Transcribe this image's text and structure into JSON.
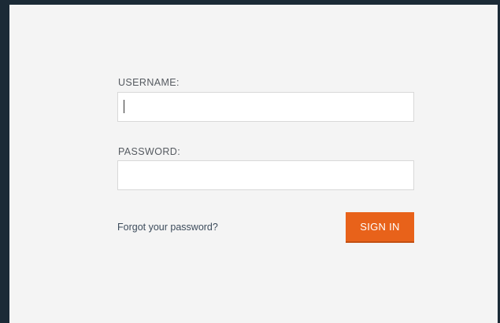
{
  "login": {
    "username_label": "USERNAME:",
    "username_value": "",
    "password_label": "PASSWORD:",
    "password_value": "",
    "forgot_link": "Forgot your password?",
    "signin_label": "SIGN IN"
  },
  "colors": {
    "frame": "#1b2a36",
    "background": "#f4f4f4",
    "accent": "#e8621a",
    "link": "#3d4c5c"
  }
}
